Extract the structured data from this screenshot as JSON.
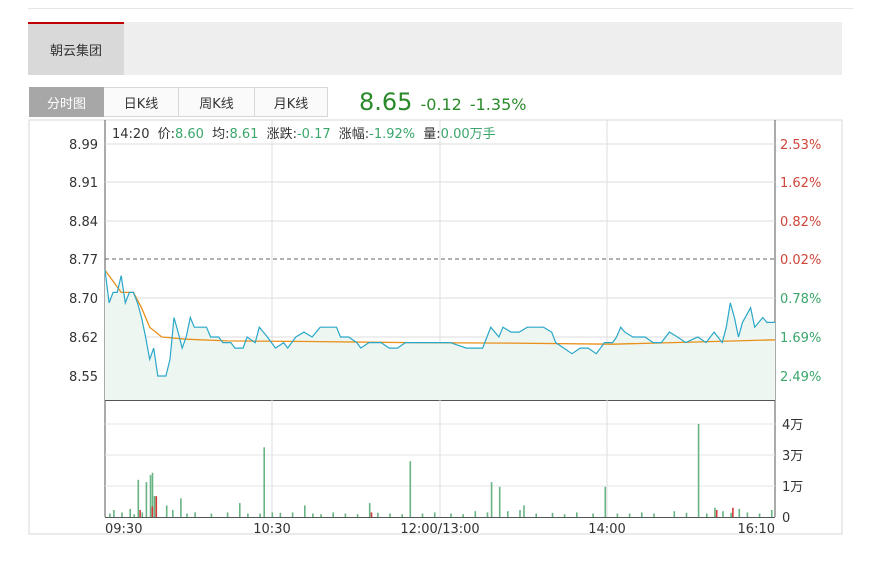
{
  "stock_tab": {
    "label": "朝云集团"
  },
  "tabs": [
    {
      "label": "分时图",
      "active": true
    },
    {
      "label": "日K线",
      "active": false
    },
    {
      "label": "周K线",
      "active": false
    },
    {
      "label": "月K线",
      "active": false
    }
  ],
  "quote": {
    "price": "8.65",
    "change": "-0.12",
    "change_pct": "-1.35%",
    "color": "#2a8a2a"
  },
  "info_line": {
    "time": "14:20",
    "price_label": "价:",
    "price": "8.60",
    "avg_label": "均:",
    "avg": "8.61",
    "change_label": "涨跌:",
    "change": "-0.17",
    "pct_label": "涨幅:",
    "pct": "-1.92%",
    "vol_label": "量:",
    "vol": "0.00万手"
  },
  "chart_data": {
    "type": "line",
    "prev_close": 8.77,
    "y_ticks": [
      "8.99",
      "8.91",
      "8.84",
      "8.77",
      "8.70",
      "8.62",
      "8.55"
    ],
    "y_range": [
      8.47,
      8.99
    ],
    "right_ticks": [
      {
        "label": "2.53%",
        "color": "#d0453a"
      },
      {
        "label": "1.62%",
        "color": "#d0453a"
      },
      {
        "label": "0.82%",
        "color": "#d0453a"
      },
      {
        "label": "0.02%",
        "color": "#d0453a"
      },
      {
        "label": "0.78%",
        "color": "#3aa66b"
      },
      {
        "label": "1.69%",
        "color": "#3aa66b"
      },
      {
        "label": "2.49%",
        "color": "#3aa66b"
      }
    ],
    "x_ticks": [
      "09:30",
      "10:30",
      "12:00/13:00",
      "14:00",
      "16:10"
    ],
    "x_range": [
      0,
      330
    ],
    "price_series": {
      "color": "#2aa7c9",
      "points": [
        [
          0,
          8.75
        ],
        [
          2,
          8.69
        ],
        [
          4,
          8.71
        ],
        [
          6,
          8.71
        ],
        [
          8,
          8.74
        ],
        [
          10,
          8.69
        ],
        [
          12,
          8.71
        ],
        [
          14,
          8.71
        ],
        [
          16,
          8.69
        ],
        [
          18,
          8.66
        ],
        [
          20,
          8.62
        ],
        [
          22,
          8.58
        ],
        [
          24,
          8.6
        ],
        [
          26,
          8.55
        ],
        [
          30,
          8.55
        ],
        [
          32,
          8.58
        ],
        [
          34,
          8.66
        ],
        [
          36,
          8.63
        ],
        [
          38,
          8.6
        ],
        [
          40,
          8.62
        ],
        [
          42,
          8.66
        ],
        [
          44,
          8.64
        ],
        [
          46,
          8.64
        ],
        [
          50,
          8.64
        ],
        [
          52,
          8.62
        ],
        [
          56,
          8.62
        ],
        [
          58,
          8.61
        ],
        [
          62,
          8.61
        ],
        [
          64,
          8.6
        ],
        [
          68,
          8.6
        ],
        [
          70,
          8.62
        ],
        [
          74,
          8.61
        ],
        [
          76,
          8.64
        ],
        [
          78,
          8.63
        ],
        [
          80,
          8.62
        ],
        [
          84,
          8.6
        ],
        [
          88,
          8.61
        ],
        [
          90,
          8.6
        ],
        [
          94,
          8.62
        ],
        [
          98,
          8.63
        ],
        [
          102,
          8.62
        ],
        [
          106,
          8.64
        ],
        [
          110,
          8.64
        ],
        [
          114,
          8.64
        ],
        [
          116,
          8.62
        ],
        [
          120,
          8.62
        ],
        [
          124,
          8.61
        ],
        [
          126,
          8.6
        ],
        [
          130,
          8.61
        ],
        [
          136,
          8.61
        ],
        [
          140,
          8.6
        ],
        [
          144,
          8.6
        ],
        [
          148,
          8.61
        ],
        [
          152,
          8.61
        ],
        [
          156,
          8.61
        ],
        [
          160,
          8.61
        ],
        [
          166,
          8.61
        ],
        [
          170,
          8.61
        ],
        [
          178,
          8.6
        ],
        [
          182,
          8.6
        ],
        [
          186,
          8.6
        ],
        [
          190,
          8.64
        ],
        [
          194,
          8.62
        ],
        [
          196,
          8.64
        ],
        [
          200,
          8.63
        ],
        [
          204,
          8.63
        ],
        [
          208,
          8.64
        ],
        [
          212,
          8.64
        ],
        [
          216,
          8.64
        ],
        [
          220,
          8.63
        ],
        [
          222,
          8.61
        ],
        [
          226,
          8.6
        ],
        [
          230,
          8.59
        ],
        [
          234,
          8.6
        ],
        [
          238,
          8.6
        ],
        [
          242,
          8.59
        ],
        [
          246,
          8.61
        ],
        [
          250,
          8.61
        ],
        [
          252,
          8.62
        ],
        [
          254,
          8.64
        ],
        [
          256,
          8.63
        ],
        [
          260,
          8.62
        ],
        [
          266,
          8.62
        ],
        [
          270,
          8.61
        ],
        [
          274,
          8.61
        ],
        [
          278,
          8.63
        ],
        [
          282,
          8.62
        ],
        [
          286,
          8.61
        ],
        [
          292,
          8.62
        ],
        [
          296,
          8.61
        ],
        [
          300,
          8.63
        ],
        [
          304,
          8.61
        ],
        [
          306,
          8.64
        ],
        [
          308,
          8.69
        ],
        [
          310,
          8.66
        ],
        [
          312,
          8.62
        ],
        [
          314,
          8.65
        ],
        [
          318,
          8.68
        ],
        [
          320,
          8.64
        ],
        [
          324,
          8.66
        ],
        [
          326,
          8.65
        ],
        [
          330,
          8.65
        ]
      ]
    },
    "avg_series": {
      "color": "#e8901a",
      "points": [
        [
          0,
          8.75
        ],
        [
          4,
          8.73
        ],
        [
          8,
          8.71
        ],
        [
          14,
          8.71
        ],
        [
          18,
          8.68
        ],
        [
          22,
          8.64
        ],
        [
          28,
          8.62
        ],
        [
          40,
          8.616
        ],
        [
          60,
          8.613
        ],
        [
          100,
          8.612
        ],
        [
          150,
          8.61
        ],
        [
          200,
          8.609
        ],
        [
          250,
          8.607
        ],
        [
          300,
          8.612
        ],
        [
          330,
          8.615
        ]
      ]
    },
    "volume": {
      "ticks": [
        "4万",
        "3万",
        "1万",
        "0"
      ],
      "max": 40000,
      "green": "#68b383",
      "red": "#d23a3a",
      "bars": [
        [
          2,
          1500
        ],
        [
          4,
          3000
        ],
        [
          8,
          2000
        ],
        [
          12,
          3500
        ],
        [
          14,
          1200
        ],
        [
          16,
          16000
        ],
        [
          18,
          2000
        ],
        [
          20,
          15000
        ],
        [
          22,
          18000
        ],
        [
          23,
          19000
        ],
        [
          24,
          9000
        ],
        [
          30,
          5000
        ],
        [
          33,
          3000
        ],
        [
          37,
          8000
        ],
        [
          40,
          1500
        ],
        [
          44,
          2000
        ],
        [
          52,
          1500
        ],
        [
          60,
          2000
        ],
        [
          66,
          6000
        ],
        [
          70,
          1500
        ],
        [
          76,
          1500
        ],
        [
          78,
          30000
        ],
        [
          82,
          2000
        ],
        [
          86,
          1800
        ],
        [
          92,
          2000
        ],
        [
          98,
          5000
        ],
        [
          102,
          1500
        ],
        [
          106,
          1200
        ],
        [
          112,
          2000
        ],
        [
          118,
          1500
        ],
        [
          124,
          1200
        ],
        [
          130,
          6000
        ],
        [
          134,
          1800
        ],
        [
          140,
          1500
        ],
        [
          146,
          1200
        ],
        [
          150,
          24000
        ],
        [
          156,
          1500
        ],
        [
          162,
          2000
        ],
        [
          170,
          1500
        ],
        [
          176,
          1200
        ],
        [
          182,
          2500
        ],
        [
          188,
          2000
        ],
        [
          190,
          15000
        ],
        [
          194,
          13000
        ],
        [
          198,
          2500
        ],
        [
          204,
          3000
        ],
        [
          206,
          5000
        ],
        [
          212,
          1500
        ],
        [
          220,
          1800
        ],
        [
          226,
          1200
        ],
        [
          232,
          2000
        ],
        [
          240,
          1500
        ],
        [
          246,
          13000
        ],
        [
          252,
          1500
        ],
        [
          258,
          1500
        ],
        [
          264,
          2000
        ],
        [
          270,
          1500
        ],
        [
          280,
          2500
        ],
        [
          286,
          1800
        ],
        [
          292,
          40000
        ],
        [
          296,
          1500
        ],
        [
          300,
          4000
        ],
        [
          304,
          2500
        ],
        [
          308,
          1800
        ],
        [
          312,
          3500
        ],
        [
          316,
          2000
        ],
        [
          322,
          1500
        ],
        [
          328,
          3000
        ]
      ],
      "red_bars": [
        [
          24,
          9000
        ],
        [
          16,
          3000
        ],
        [
          22,
          4500
        ],
        [
          130,
          2000
        ],
        [
          300,
          3000
        ],
        [
          308,
          4000
        ]
      ]
    }
  }
}
